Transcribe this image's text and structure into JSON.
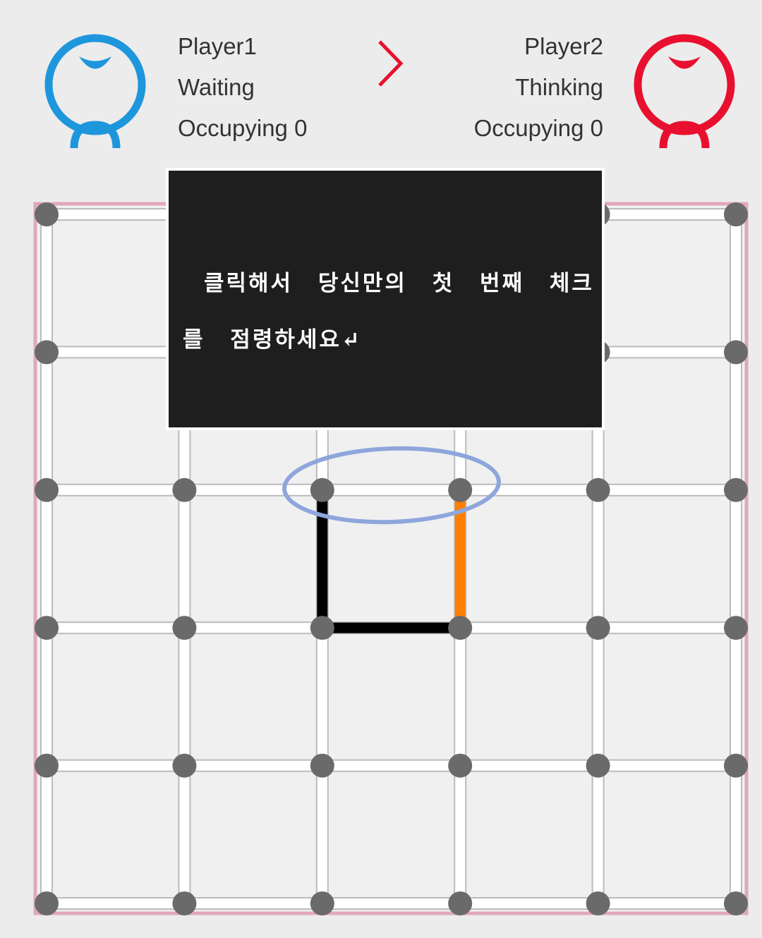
{
  "players": [
    {
      "name": "Player1",
      "status": "Waiting",
      "occupying": "Occupying 0",
      "color": "#1e96dc"
    },
    {
      "name": "Player2",
      "status": "Thinking",
      "occupying": "Occupying 0",
      "color": "#e8102e"
    }
  ],
  "turn_indicator": {
    "icon": "chevron-right-icon",
    "color": "#e8102e"
  },
  "board": {
    "dots_per_side": 6,
    "border_color": "#e0a8b8",
    "dot_color": "#6a6a6a",
    "drawn_lines": [
      {
        "from": [
          2,
          2
        ],
        "to": [
          2,
          3
        ],
        "color": "#000000"
      },
      {
        "from": [
          2,
          3
        ],
        "to": [
          3,
          3
        ],
        "color": "#000000"
      },
      {
        "from": [
          3,
          2
        ],
        "to": [
          3,
          3
        ],
        "color": "#ff7f00"
      }
    ],
    "highlight_color": "#8ea6dc"
  },
  "annotation": {
    "text": "클릭해서 당신만의 첫 번째 체크를 점령하세요↵"
  }
}
